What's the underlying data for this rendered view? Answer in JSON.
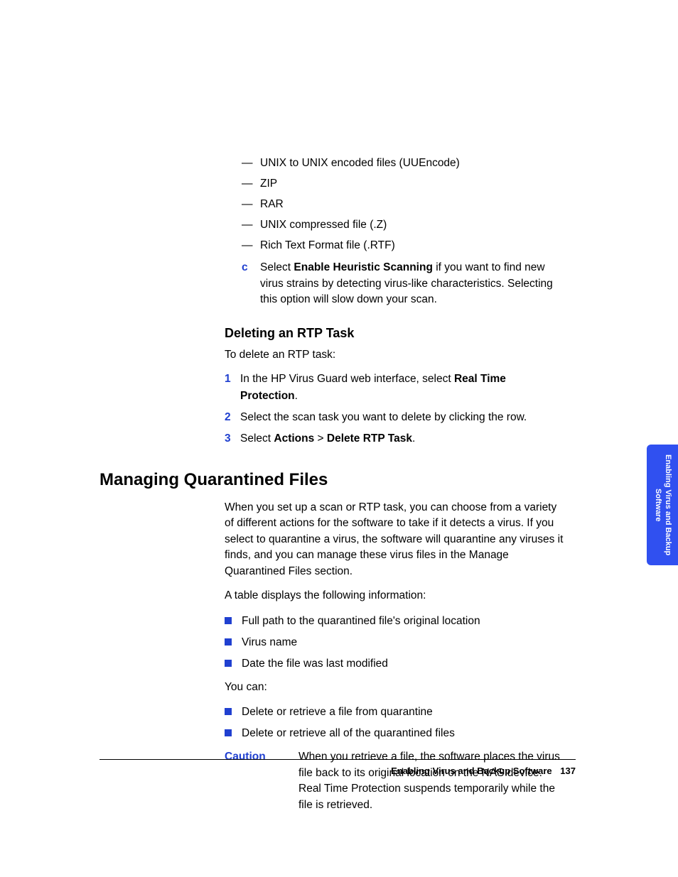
{
  "dash_items": [
    "UNIX to UNIX encoded files (UUEncode)",
    "ZIP",
    "RAR",
    "UNIX compressed file (.Z)",
    "Rich Text Format file (.RTF)"
  ],
  "step_c": {
    "marker": "c",
    "pre": "Select ",
    "bold": "Enable Heuristic Scanning",
    "post": " if you want to find new virus strains by detecting virus-like characteristics. Selecting this option will slow down your scan."
  },
  "delete_section": {
    "heading": "Deleting an RTP Task",
    "intro": "To delete an RTP task:",
    "steps": [
      {
        "n": "1",
        "pre": "In the HP Virus Guard web interface, select ",
        "bold": "Real Time Protection",
        "post": "."
      },
      {
        "n": "2",
        "pre": "Select the scan task you want to delete by clicking the row.",
        "bold": "",
        "post": ""
      },
      {
        "n": "3",
        "pre": "Select ",
        "bold": "Actions",
        "mid": " > ",
        "bold2": "Delete RTP Task",
        "post": "."
      }
    ]
  },
  "quarantine": {
    "heading": "Managing Quarantined Files",
    "para1": "When you set up a scan or RTP task, you can choose from a variety of different actions for the software to take if it detects a virus. If you select to quarantine a virus, the software will quarantine any viruses it finds, and you can manage these virus files in the Manage Quarantined Files section.",
    "para2": "A table displays the following information:",
    "info_list": [
      "Full path to the quarantined file's original location",
      "Virus name",
      "Date the file was last modified"
    ],
    "para3": "You can:",
    "action_list": [
      "Delete or retrieve a file from quarantine",
      "Delete or retrieve all of the quarantined files"
    ],
    "caution_label": "Caution",
    "caution_text": "When you retrieve a file, the software places the virus file back to its original location on the NAS device. Real Time Protection suspends temporarily while the file is retrieved."
  },
  "side_tab": "Enabling Virus and Backup Software",
  "footer": {
    "title": "Enabling Virus and Backup Software",
    "page": "137"
  }
}
